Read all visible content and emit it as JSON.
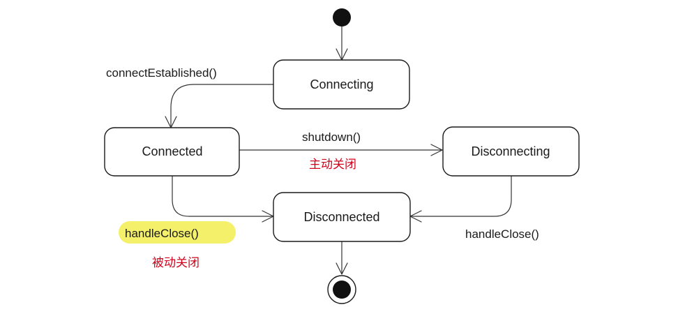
{
  "colors": {
    "annotation": "#d0021b",
    "highlight": "#f5f06a",
    "line": "#333333"
  },
  "states": {
    "connecting": "Connecting",
    "connected": "Connected",
    "disconnecting": "Disconnecting",
    "disconnected": "Disconnected"
  },
  "transitions": {
    "connect_established": "connectEstablished()",
    "shutdown": "shutdown()",
    "handle_close_left": "handleClose()",
    "handle_close_right": "handleClose()"
  },
  "annotations": {
    "active_close": "主动关闭",
    "passive_close": "被动关闭"
  }
}
